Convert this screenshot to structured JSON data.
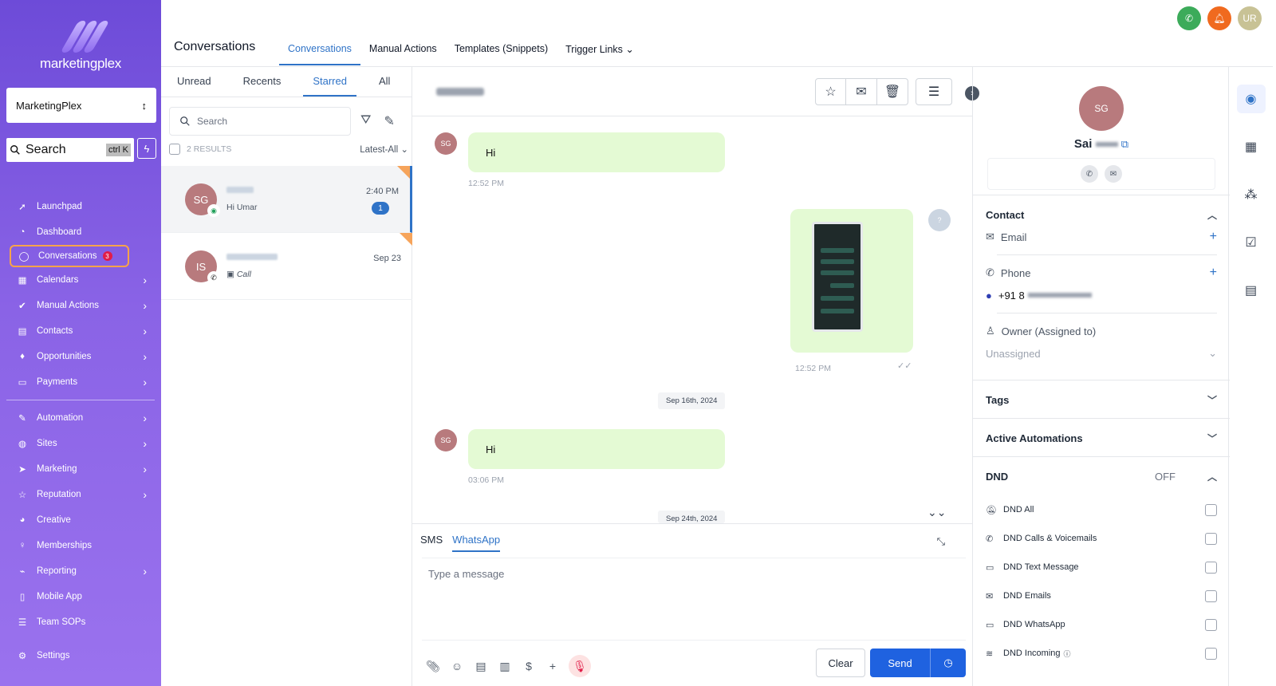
{
  "sidebar": {
    "brand": "marketingplex",
    "account": "MarketingPlex",
    "search": {
      "label": "Search",
      "shortcut": "ctrl K"
    },
    "nav": [
      {
        "label": "Launchpad",
        "icon": "rocket-icon"
      },
      {
        "label": "Dashboard",
        "icon": "dashboard-icon"
      },
      {
        "label": "Conversations",
        "icon": "chat-icon",
        "badge": "3",
        "active": true
      },
      {
        "label": "Calendars",
        "icon": "calendar-icon"
      },
      {
        "label": "Manual Actions",
        "icon": "check-circle-icon"
      },
      {
        "label": "Contacts",
        "icon": "contacts-icon"
      },
      {
        "label": "Opportunities",
        "icon": "opportunities-icon"
      },
      {
        "label": "Payments",
        "icon": "payments-icon"
      },
      {
        "label": "Automation",
        "icon": "automation-icon"
      },
      {
        "label": "Sites",
        "icon": "globe-icon"
      },
      {
        "label": "Marketing",
        "icon": "send-icon"
      },
      {
        "label": "Reputation",
        "icon": "star-icon"
      },
      {
        "label": "Creative",
        "icon": "palette-icon"
      },
      {
        "label": "Memberships",
        "icon": "memberships-icon"
      },
      {
        "label": "Reporting",
        "icon": "chart-icon"
      },
      {
        "label": "Mobile App",
        "icon": "mobile-icon"
      },
      {
        "label": "Team SOPs",
        "icon": "list-icon"
      }
    ],
    "settings": "Settings"
  },
  "header": {
    "title": "Conversations",
    "tabs": [
      "Conversations",
      "Manual Actions",
      "Templates (Snippets)",
      "Trigger Links"
    ],
    "user_initials": "UR"
  },
  "list": {
    "filters": [
      "Unread",
      "Recents",
      "Starred",
      "All"
    ],
    "search_placeholder": "Search",
    "results": "2 RESULTS",
    "sort": "Latest-All",
    "items": [
      {
        "initials": "SG",
        "preview": "Hi Umar",
        "time": "2:40 PM",
        "unread": "1"
      },
      {
        "initials": "IS",
        "preview": "Call",
        "time": "Sep 23"
      }
    ]
  },
  "chat": {
    "messages": [
      {
        "text": "Hi",
        "time": "12:52 PM",
        "avatar": "SG"
      },
      {
        "time": "12:52 PM"
      },
      {
        "text": "Hi",
        "time": "03:06 PM",
        "avatar": "SG"
      }
    ],
    "dates": [
      "Sep 16th, 2024",
      "Sep 24th, 2024"
    ],
    "composer": {
      "tabs": [
        "SMS",
        "WhatsApp"
      ],
      "placeholder": "Type a message",
      "clear": "Clear",
      "send": "Send"
    }
  },
  "contact": {
    "initials": "SG",
    "name": "Sai",
    "section_contact": "Contact",
    "email_label": "Email",
    "phone_label": "Phone",
    "phone_value": "+91 8",
    "owner_label": "Owner (Assigned to)",
    "owner_value": "Unassigned",
    "tags": "Tags",
    "automations": "Active Automations",
    "dnd": "DND",
    "dnd_status": "OFF",
    "dnd_items": [
      "DND All",
      "DND Calls & Voicemails",
      "DND Text Message",
      "DND Emails",
      "DND WhatsApp",
      "DND Incoming"
    ]
  },
  "colors": {
    "accent": "#2f73c7",
    "sidebar": "#7c58e2",
    "bubble": "#e4fad4",
    "send": "#1f62e0"
  }
}
